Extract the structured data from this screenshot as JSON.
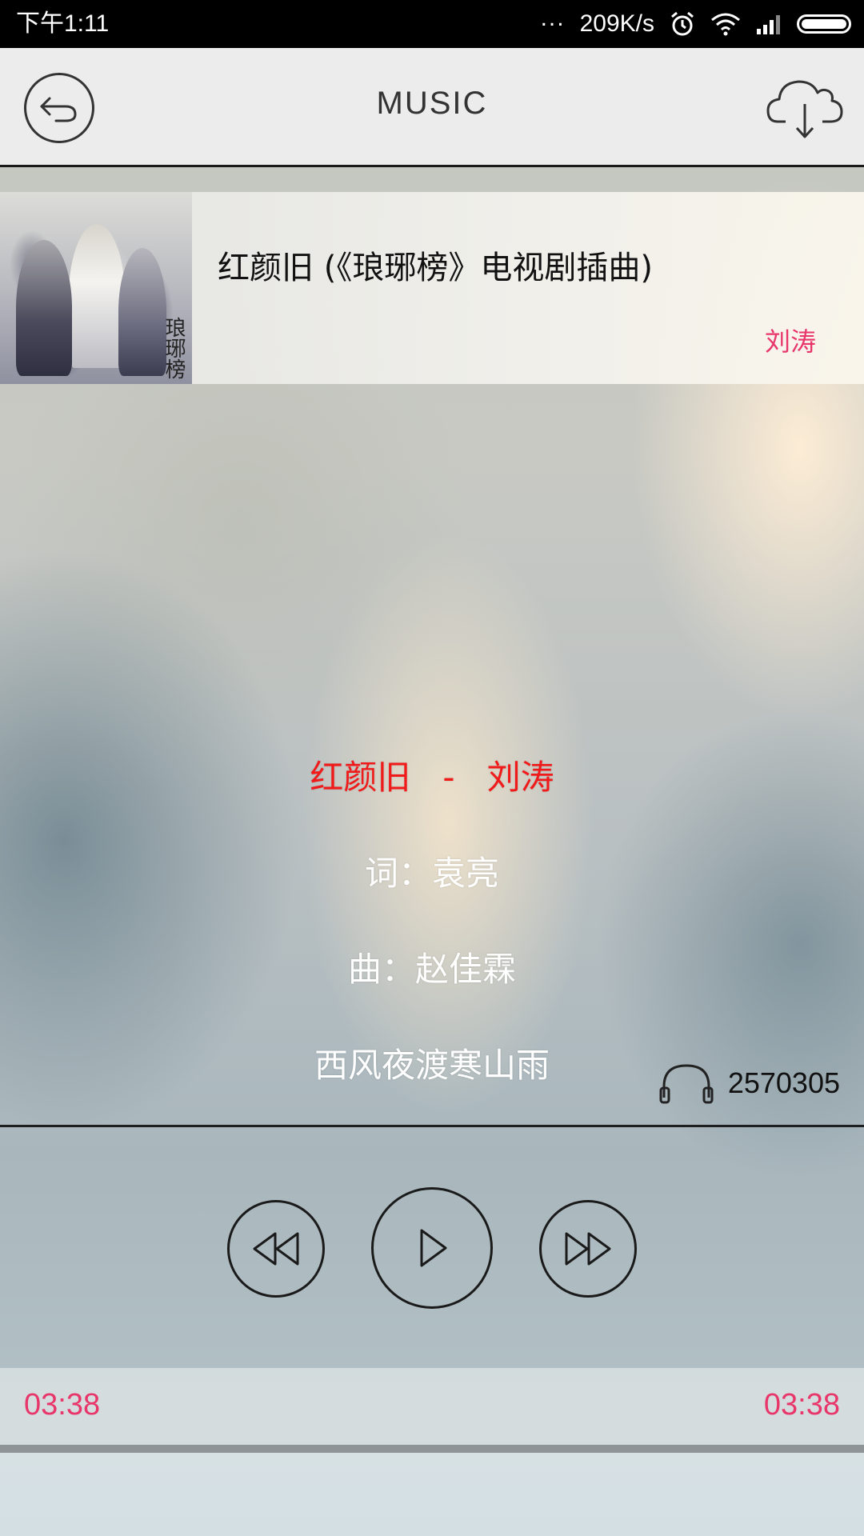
{
  "status_bar": {
    "time": "下午1:11",
    "dots": "...",
    "network_speed": "209K/s",
    "icons": [
      "alarm-icon",
      "wifi-icon",
      "signal-icon",
      "battery-icon"
    ]
  },
  "header": {
    "title": "MUSIC",
    "back_icon": "back-arrow-icon",
    "download_icon": "cloud-download-icon"
  },
  "song": {
    "title": "红颜旧 (《琅琊榜》电视剧插曲)",
    "artist": "刘涛",
    "cover_text": "琅琊榜"
  },
  "lyrics": {
    "active": {
      "song": "红颜旧",
      "dash": "-",
      "artist": "刘涛"
    },
    "lines": [
      "词：袁亮",
      "曲：赵佳霖",
      "西风夜渡寒山雨"
    ]
  },
  "play_count": {
    "icon": "headphones-icon",
    "value": "2570305"
  },
  "controls": {
    "prev_icon": "rewind-icon",
    "play_icon": "play-icon",
    "next_icon": "fast-forward-icon"
  },
  "time": {
    "current": "03:38",
    "duration": "03:38",
    "progress": 1.0
  },
  "colors": {
    "accent": "#e8356a",
    "active_lyric": "#f11a1a",
    "header_bg": "#ececec"
  }
}
